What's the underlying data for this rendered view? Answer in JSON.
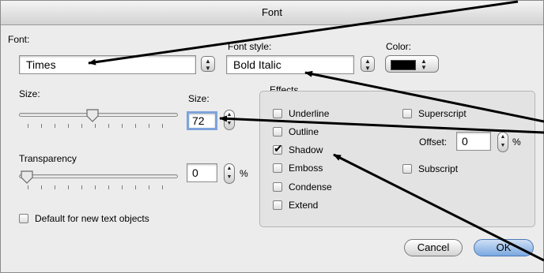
{
  "window": {
    "title": "Font"
  },
  "font": {
    "label": "Font:",
    "value": "Times"
  },
  "font_style": {
    "label": "Font style:",
    "value": "Bold Italic"
  },
  "color": {
    "label": "Color:",
    "value": "#000000"
  },
  "size": {
    "slider_label": "Size:",
    "field_label": "Size:",
    "value": "72"
  },
  "transparency": {
    "label": "Transparency",
    "value": "0",
    "unit": "%"
  },
  "effects": {
    "title": "Effects",
    "underline": "Underline",
    "outline": "Outline",
    "shadow": "Shadow",
    "emboss": "Emboss",
    "condense": "Condense",
    "extend": "Extend",
    "superscript": "Superscript",
    "offset_label": "Offset:",
    "offset_value": "0",
    "offset_unit": "%",
    "subscript": "Subscript",
    "checked": {
      "underline": false,
      "outline": false,
      "shadow": true,
      "emboss": false,
      "condense": false,
      "extend": false,
      "superscript": false,
      "subscript": false
    }
  },
  "default_checkbox": {
    "label": "Default for new text objects",
    "checked": false
  },
  "buttons": {
    "cancel": "Cancel",
    "ok": "OK"
  },
  "annotation_color": "#000000"
}
